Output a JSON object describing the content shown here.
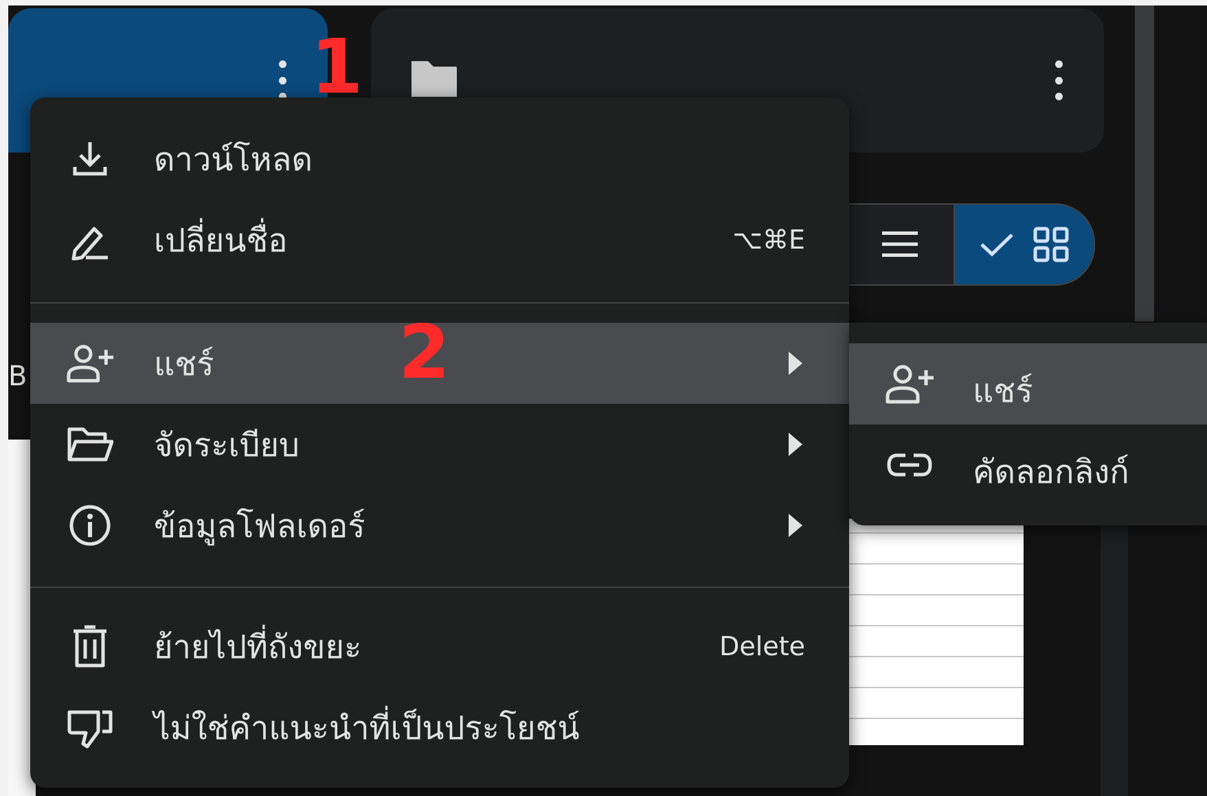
{
  "annotations": {
    "marker_1": "1",
    "marker_2": "2"
  },
  "background": {
    "partial_letter": "B"
  },
  "context_menu": {
    "items": [
      {
        "label": "ดาวน์โหลด",
        "icon": "download-icon"
      },
      {
        "label": "เปลี่ยนชื่อ",
        "icon": "rename-icon",
        "shortcut": "⌥⌘E"
      },
      {
        "label": "แชร์",
        "icon": "person-add-icon",
        "submenu": true,
        "highlighted": true
      },
      {
        "label": "จัดระเบียบ",
        "icon": "folder-open-icon",
        "submenu": true
      },
      {
        "label": "ข้อมูลโฟลเดอร์",
        "icon": "info-icon",
        "submenu": true
      },
      {
        "label": "ย้ายไปที่ถังขยะ",
        "icon": "trash-icon",
        "shortcut": "Delete"
      },
      {
        "label": "ไม่ใช่คำแนะนำที่เป็นประโยชน์",
        "icon": "thumbs-down-icon"
      }
    ]
  },
  "share_submenu": {
    "items": [
      {
        "label": "แชร์",
        "icon": "person-add-icon",
        "highlighted": true
      },
      {
        "label": "คัดลอกลิงก์",
        "icon": "link-icon"
      }
    ]
  },
  "colors": {
    "accent_blue": "#0b4a7d",
    "menu_bg": "#1f2020",
    "highlight": "#4a4b4e",
    "annotation_red": "#ff2a2a"
  }
}
